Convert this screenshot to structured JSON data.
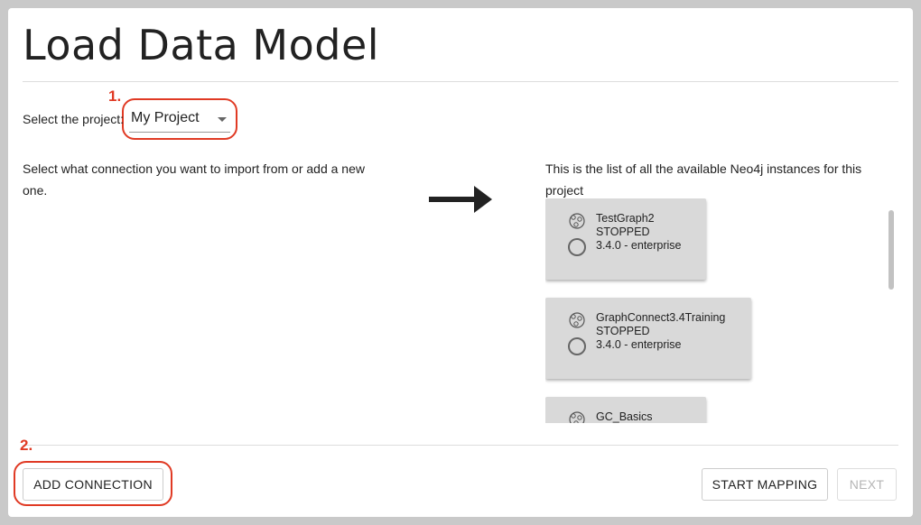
{
  "page_title": "Load Data Model",
  "annotations": {
    "step1": "1.",
    "step2": "2."
  },
  "project": {
    "label": "Select the project:",
    "selected": "My Project"
  },
  "left_instruction": "Select what connection you want to import from or add a new one.",
  "right_instruction": "This is the list of all the available Neo4j instances for this project",
  "instances": [
    {
      "name": "TestGraph2",
      "status": "STOPPED",
      "version": "3.4.0 - enterprise"
    },
    {
      "name": "GraphConnect3.4Training",
      "status": "STOPPED",
      "version": "3.4.0 - enterprise"
    },
    {
      "name": "GC_Basics",
      "status": "",
      "version": ""
    }
  ],
  "buttons": {
    "add_connection": "ADD CONNECTION",
    "start_mapping": "START MAPPING",
    "next": "NEXT"
  },
  "colors": {
    "annotation": "#e03a24",
    "card": "#d9d9d9"
  }
}
